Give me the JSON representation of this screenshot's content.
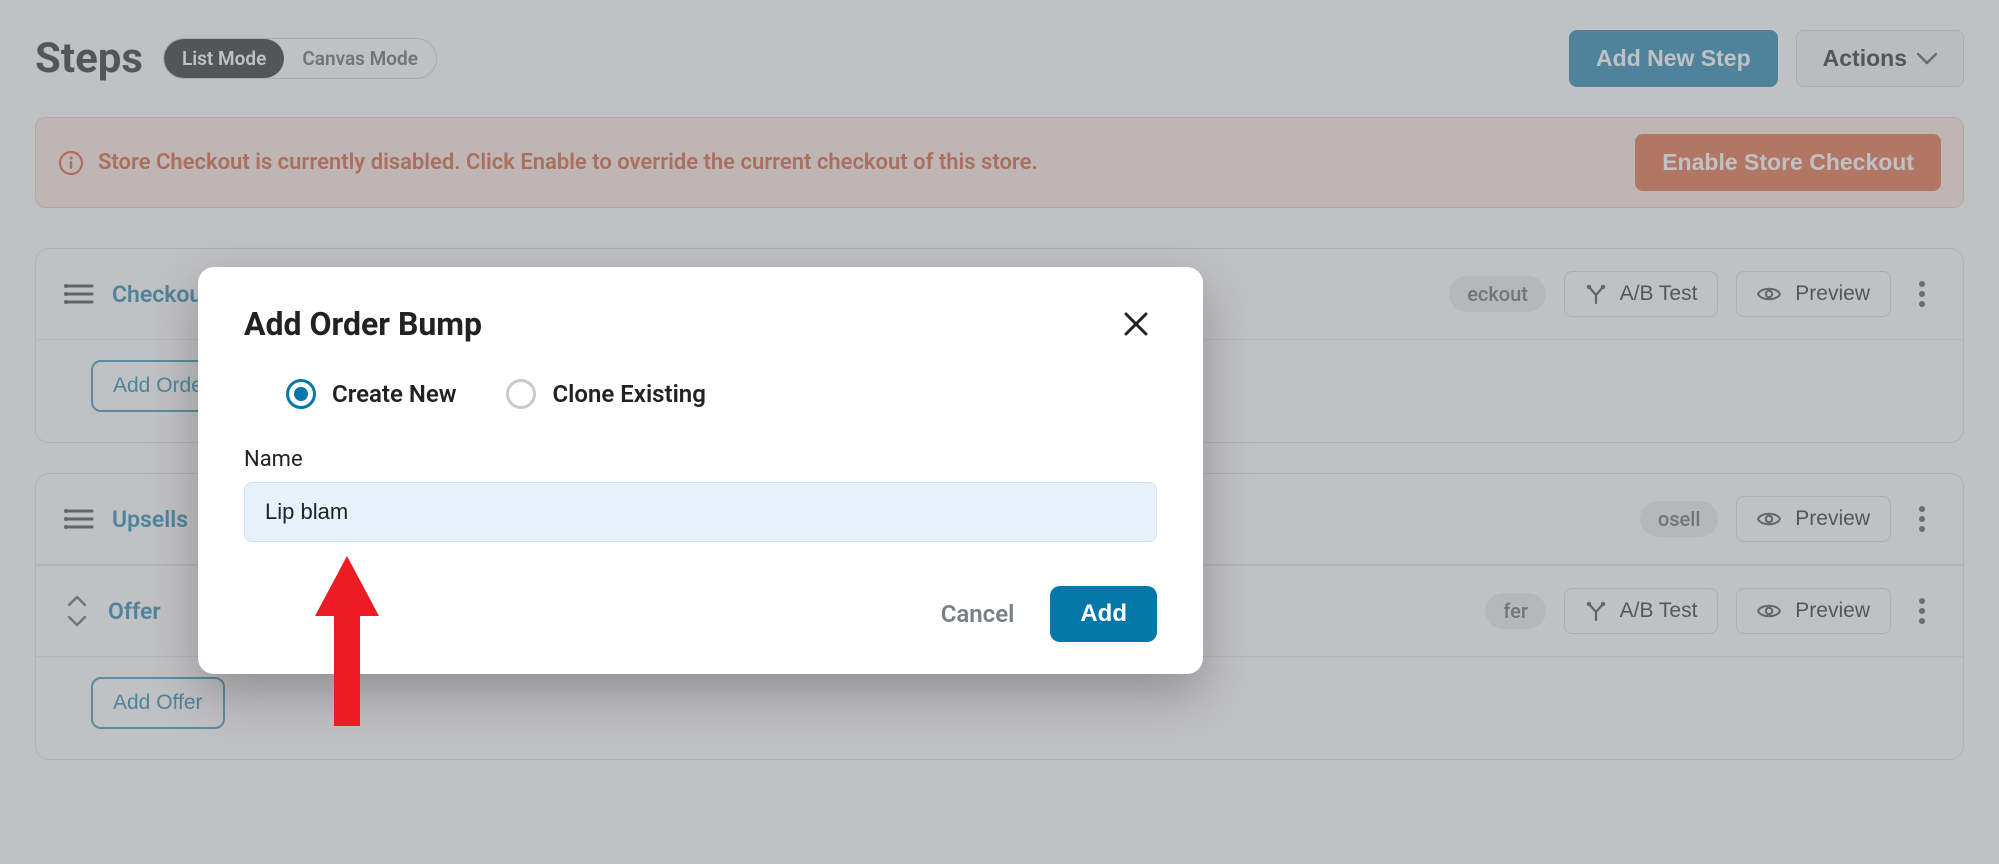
{
  "header": {
    "title": "Steps",
    "mode_list": "List Mode",
    "mode_canvas": "Canvas Mode",
    "add_new_step": "Add New Step",
    "actions": "Actions"
  },
  "alert": {
    "text": "Store Checkout is currently disabled. Click Enable to override the current checkout of this store.",
    "button": "Enable Store Checkout"
  },
  "steps": [
    {
      "name": "Checkout",
      "tag": "eckout",
      "buttons": {
        "ab": "A/B Test",
        "preview": "Preview"
      },
      "sub_action": "Add Order"
    },
    {
      "name": "Upsells",
      "tag": "osell",
      "buttons": {
        "preview": "Preview"
      },
      "offer_row": {
        "name": "Offer",
        "tag": "fer",
        "buttons": {
          "ab": "A/B Test",
          "preview": "Preview"
        }
      },
      "sub_action": "Add Offer"
    }
  ],
  "modal": {
    "title": "Add Order Bump",
    "options": {
      "create": "Create New",
      "clone": "Clone Existing"
    },
    "selected": "create",
    "field_label": "Name",
    "field_value": "Lip blam",
    "cancel": "Cancel",
    "add": "Add"
  }
}
